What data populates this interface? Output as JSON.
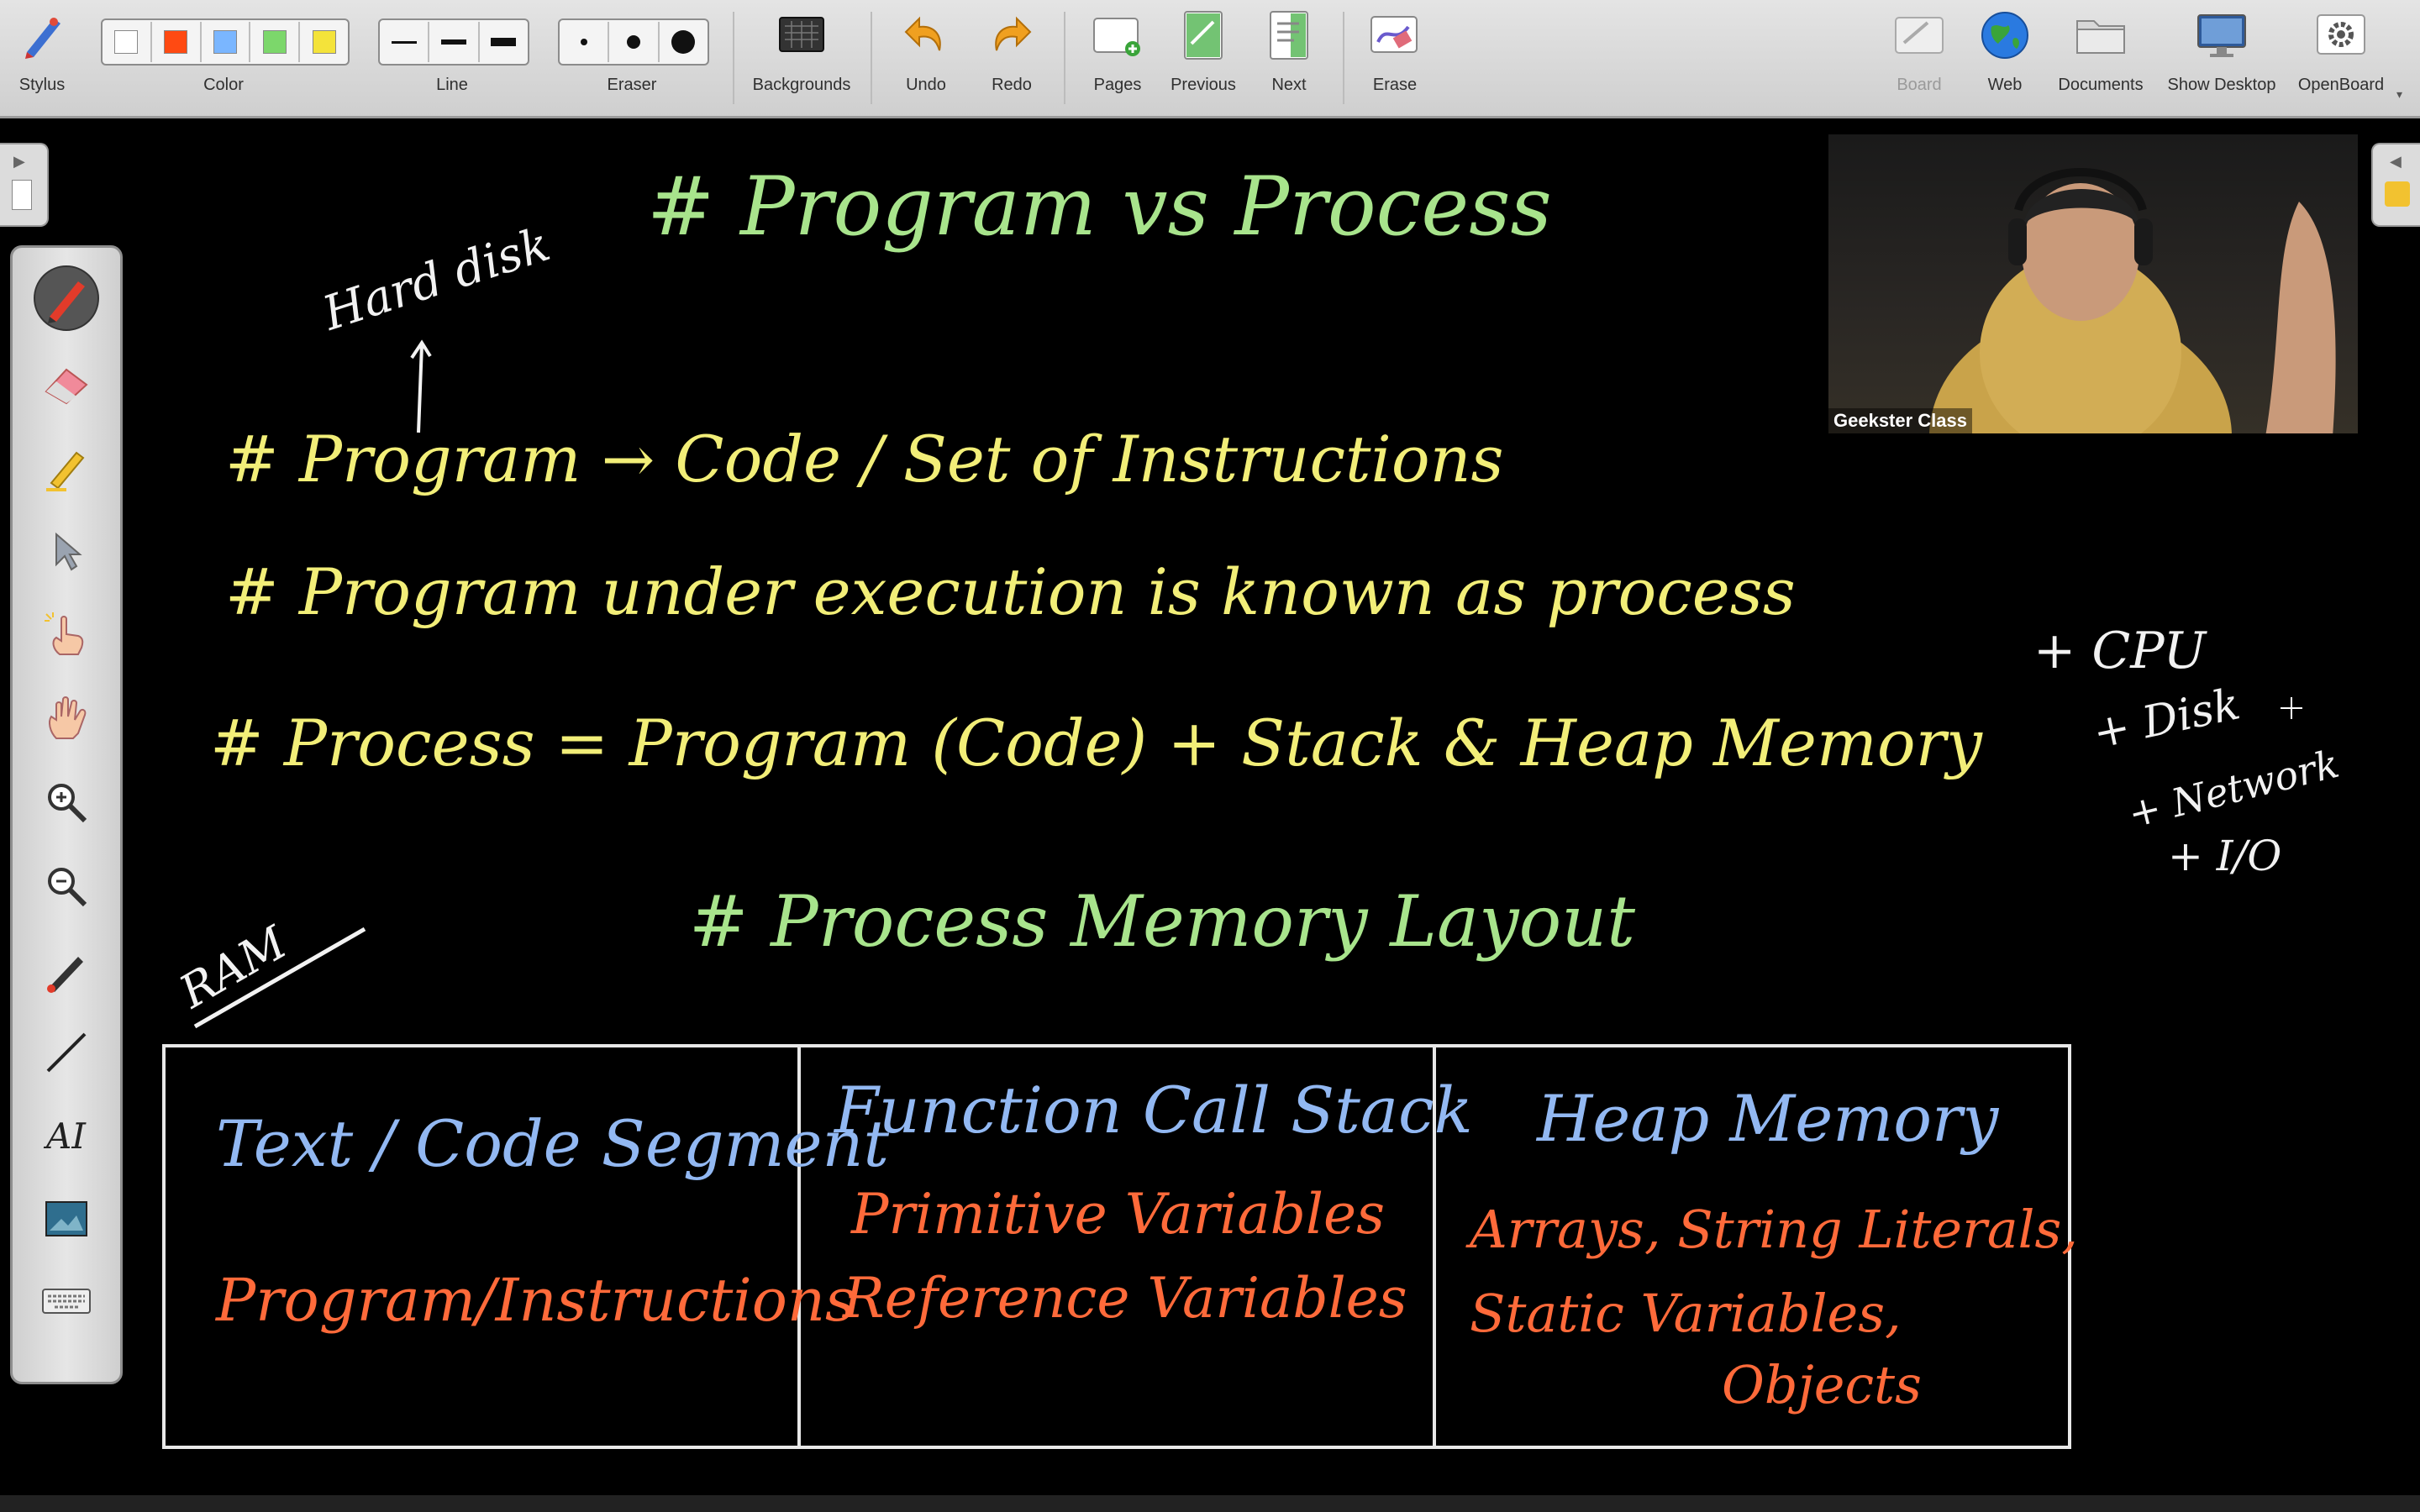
{
  "toolbar": {
    "stylus": "Stylus",
    "color": "Color",
    "line": "Line",
    "eraser": "Eraser",
    "backgrounds": "Backgrounds",
    "undo": "Undo",
    "redo": "Redo",
    "pages": "Pages",
    "previous": "Previous",
    "next": "Next",
    "erase": "Erase",
    "board": "Board",
    "web": "Web",
    "documents": "Documents",
    "show_desktop": "Show Desktop",
    "openboard": "OpenBoard",
    "colors": [
      "#ffffff",
      "#ff4a12",
      "#7ab6ff",
      "#7cd76b",
      "#f4e33a"
    ]
  },
  "video": {
    "name": "Geekster Class"
  },
  "board": {
    "title": "# Program vs Process",
    "hard_disk": "Hard disk",
    "line1": "# Program → Code / Set of Instructions",
    "line2": "# Program under execution is known as process",
    "line3": "# Process = Program (Code) + Stack & Heap Memory",
    "extra_cpu": "+ CPU",
    "extra_disk": "+ Disk",
    "extra_network": "+ Network",
    "extra_io": "+ I/O",
    "layout_title": "# Process Memory Layout",
    "ram": "RAM",
    "cells": [
      {
        "title": "Text / Code Segment",
        "lines": [
          "Program/Instructions"
        ]
      },
      {
        "title": "Function Call Stack",
        "lines": [
          "Primitive Variables",
          "Reference Variables"
        ]
      },
      {
        "title": "Heap Memory",
        "lines": [
          "Arrays, String Literals,",
          "Static Variables,",
          "Objects"
        ]
      }
    ]
  }
}
